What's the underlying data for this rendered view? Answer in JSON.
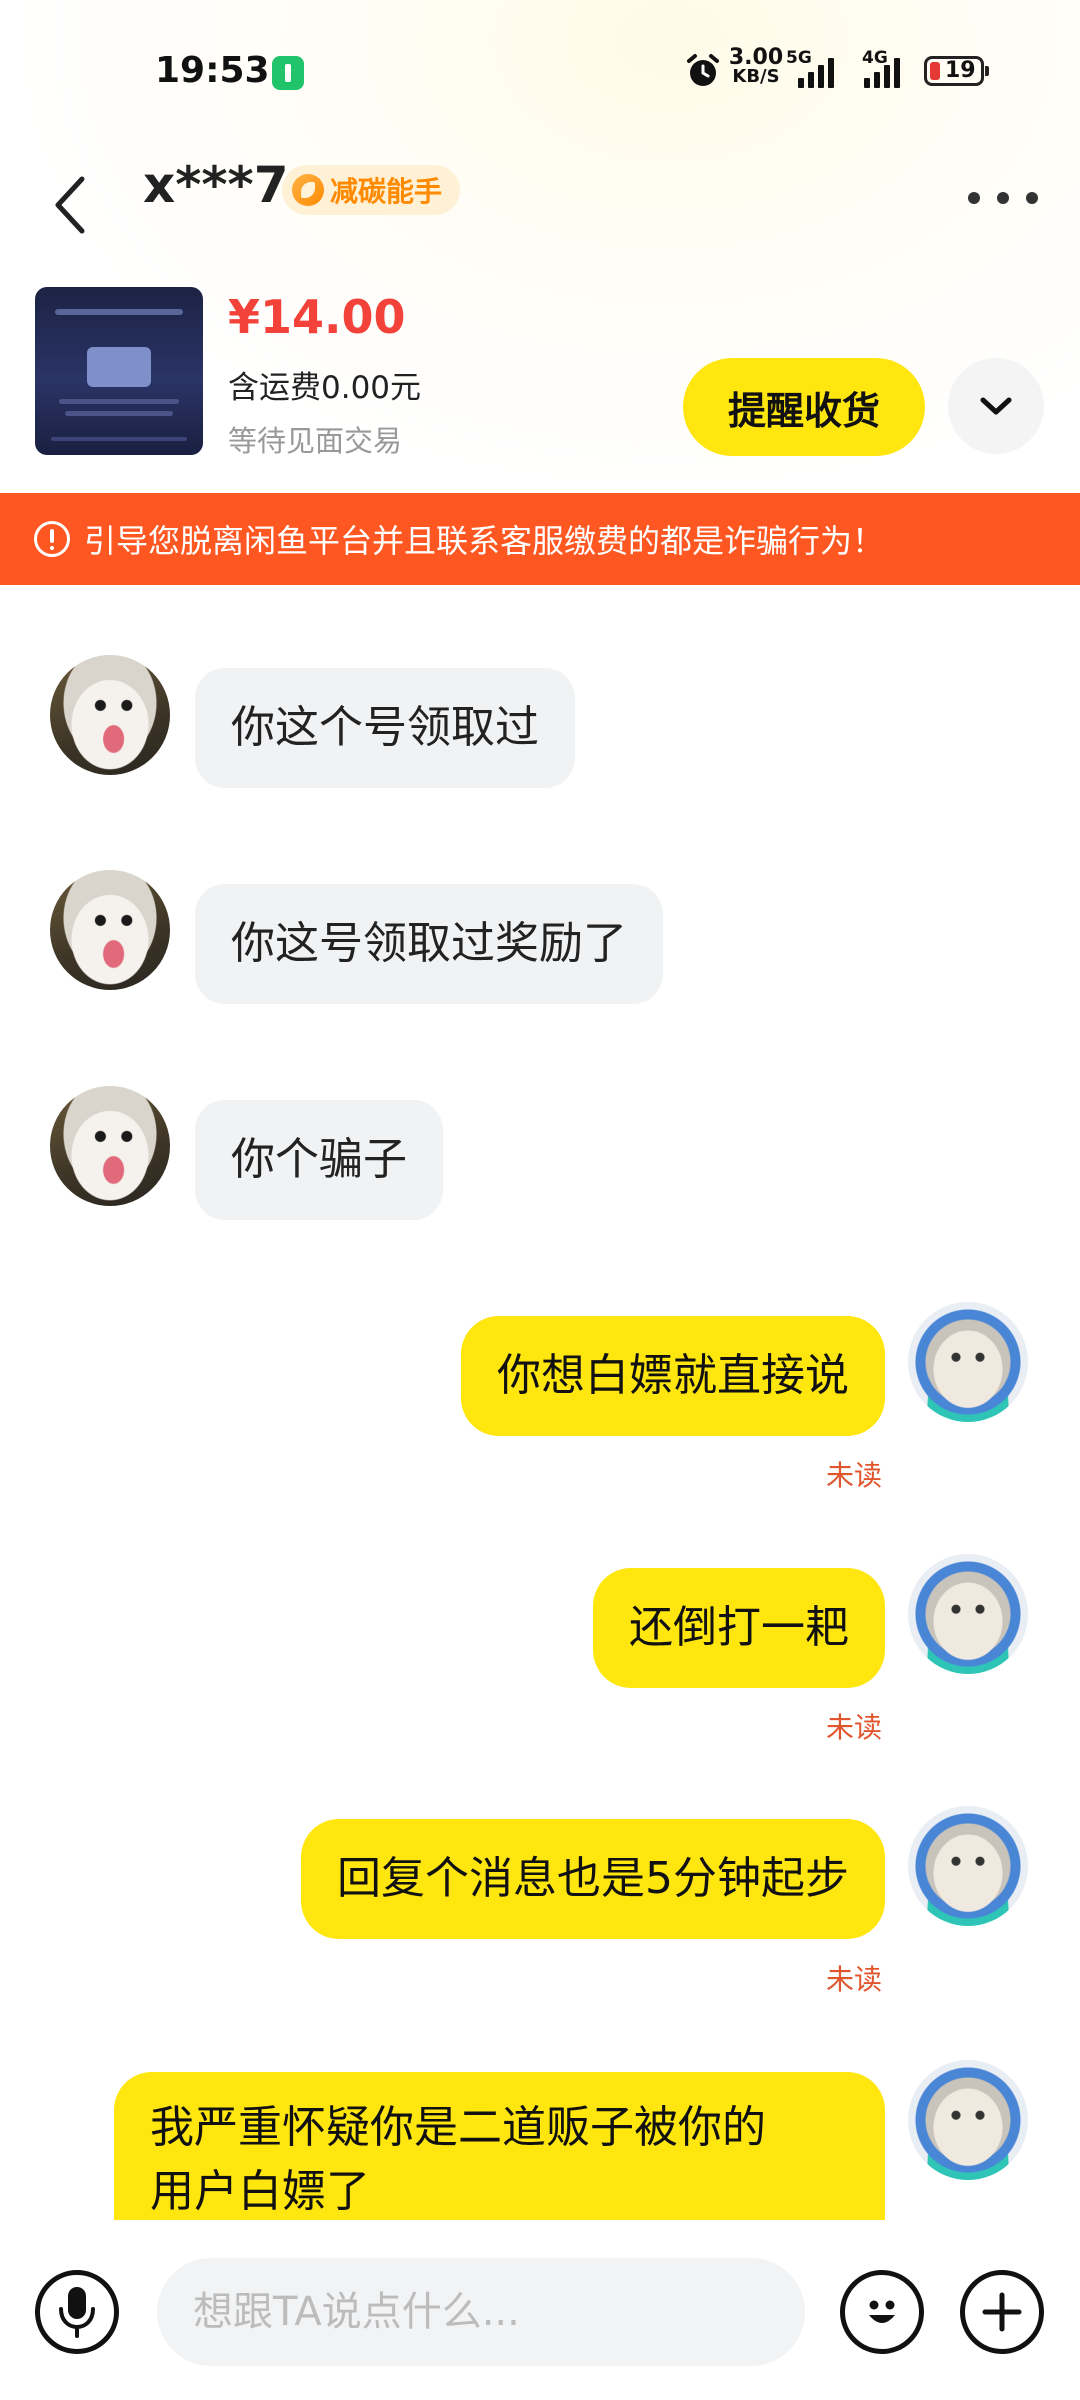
{
  "status_bar": {
    "time": "19:53",
    "net_speed_value": "3.00",
    "net_speed_unit": "KB/S",
    "net_type_1": "5G",
    "net_type_2": "4G",
    "battery_level": "19"
  },
  "header": {
    "nickname": "x***7",
    "badge_label": "减碳能手"
  },
  "product": {
    "price": "¥14.00",
    "shipping": "含运费0.00元",
    "trade_status": "等待见面交易",
    "remind_button": "提醒收货"
  },
  "warning": {
    "text": "引导您脱离闲鱼平台并且联系客服缴费的都是诈骗行为！"
  },
  "messages": [
    {
      "from": "other",
      "text": "你这个号领取过"
    },
    {
      "from": "other",
      "text": "你这号领取过奖励了"
    },
    {
      "from": "other",
      "text": "你个骗子"
    },
    {
      "from": "me",
      "text": "你想白嫖就直接说",
      "status": "未读"
    },
    {
      "from": "me",
      "text": "还倒打一耙",
      "status": "未读"
    },
    {
      "from": "me",
      "text": "回复个消息也是5分钟起步",
      "status": "未读"
    },
    {
      "from": "me",
      "text_line1": "我严重怀疑你是二道贩子被你的",
      "text_line2": "用户白嫖了"
    }
  ],
  "input": {
    "placeholder": "想跟TA说点什么..."
  },
  "colors": {
    "accent_yellow": "#ffe60f",
    "price_red": "#f2423a",
    "warning_orange": "#ff5722",
    "unread_red": "#e0552b",
    "badge_orange": "#ff8a00"
  },
  "icons": [
    "back-icon",
    "more-icon",
    "chevron-down-icon",
    "warning-icon",
    "microphone-icon",
    "emoji-icon",
    "plus-icon",
    "alarm-icon",
    "charging-icon"
  ]
}
